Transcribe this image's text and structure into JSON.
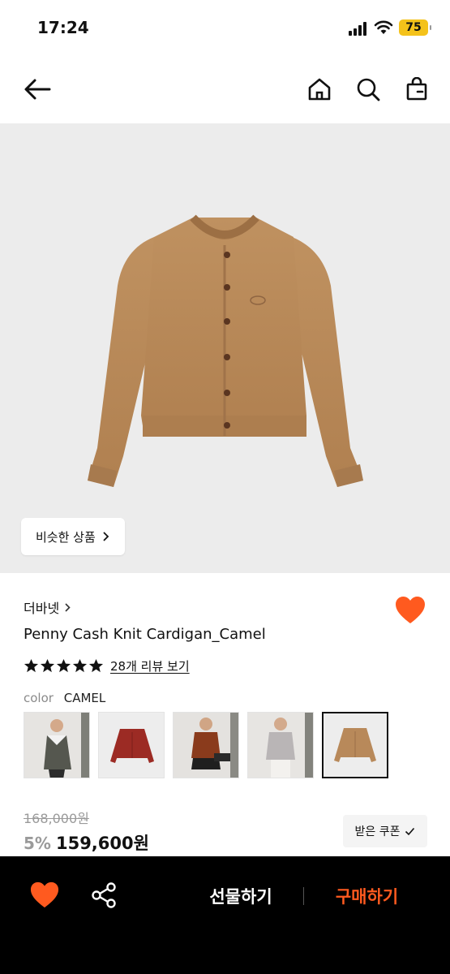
{
  "status_bar": {
    "time": "17:24",
    "battery": "75"
  },
  "nav": {
    "back_icon": "arrow-left-icon",
    "home_icon": "home-icon",
    "search_icon": "search-icon",
    "bag_icon": "shopping-bag-icon"
  },
  "hero": {
    "similar_button_label": "비슷한 상품"
  },
  "product": {
    "brand": "더바넷",
    "name": "Penny Cash Knit Cardigan_Camel",
    "rating": 5,
    "review_link": "28개 리뷰 보기",
    "color_label": "color",
    "color_value": "CAMEL",
    "original_price": "168,000원",
    "discount": "5%",
    "price": "159,600원",
    "coupon_label": "받은 쿠폰"
  },
  "thumbnails": [
    {
      "name": "thumb-model-grey-cardigan"
    },
    {
      "name": "thumb-red-cardigan"
    },
    {
      "name": "thumb-model-brown-cardigan"
    },
    {
      "name": "thumb-model-grey-melange-cardigan"
    },
    {
      "name": "thumb-camel-cardigan",
      "selected": true
    }
  ],
  "bottom_bar": {
    "gift_label": "선물하기",
    "buy_label": "구매하기"
  },
  "colors": {
    "accent": "#ff5a1f",
    "heart": "#ff5a1f",
    "bottom_bar_bg": "#000000",
    "cardigan": "#b8895a"
  }
}
